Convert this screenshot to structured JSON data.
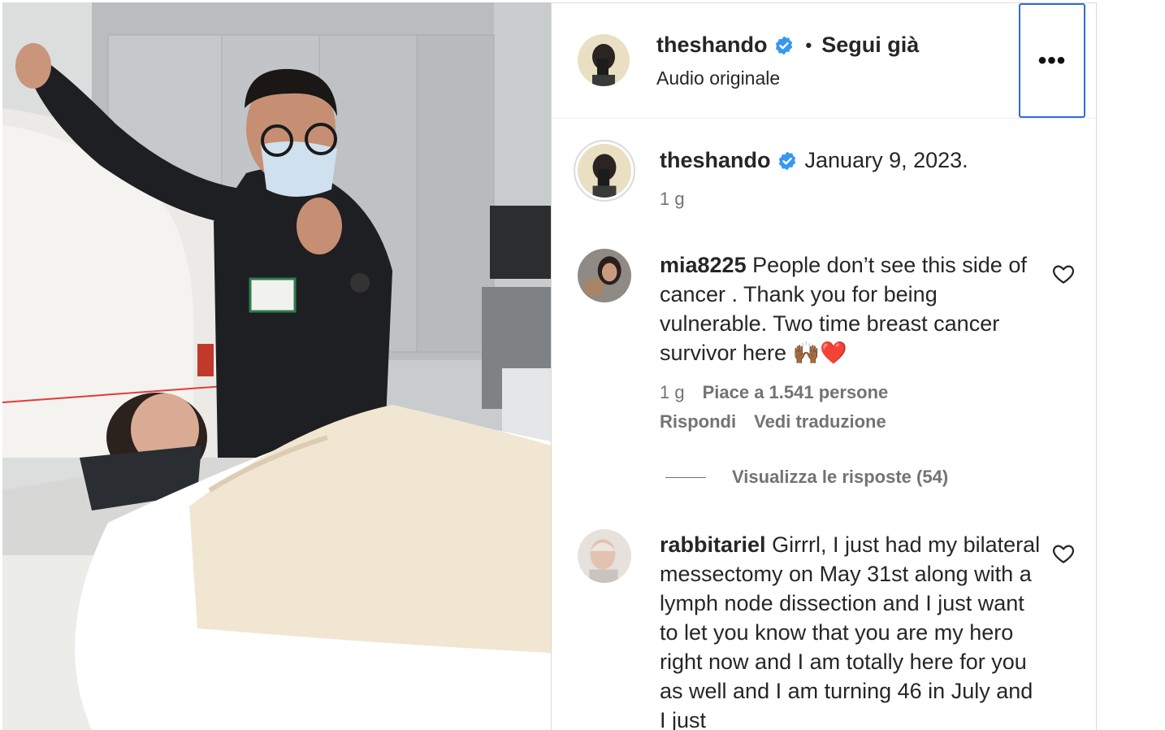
{
  "post": {
    "username": "theshando",
    "separator": "•",
    "follow_label": "Segui già",
    "audio_label": "Audio originale",
    "more_label": "•••"
  },
  "caption": {
    "username": "theshando",
    "text": "January 9, 2023.",
    "time": "1 g"
  },
  "comments": [
    {
      "username": "mia8225",
      "text": "People don’t see this side of cancer . Thank you for being vulnerable. Two time breast cancer survivor here 🙌🏾❤️",
      "time": "1 g",
      "likes": "Piace a 1.541 persone",
      "reply_label": "Rispondi",
      "translate_label": "Vedi traduzione",
      "view_replies_label": "Visualizza le risposte (54)"
    },
    {
      "username": "rabbitariel",
      "text": "Girrrl, I just had my bilateral messectomy on May 31st along with a lymph node dissection and I just want to let you know that you are my hero right now and I am totally here for you as well and I am turning 46 in July and I just"
    }
  ],
  "colors": {
    "verified": "#3897f0",
    "focus_ring": "#2f6bd8",
    "secondary_text": "#737373"
  },
  "icons": [
    "verified-badge-icon",
    "more-options-icon",
    "heart-icon"
  ]
}
